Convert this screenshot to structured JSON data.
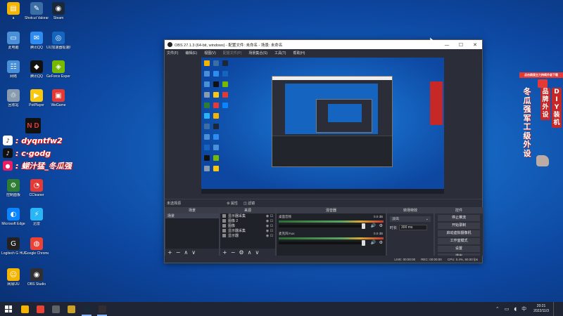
{
  "desktop": {
    "icons": [
      {
        "label": "a",
        "color": "#f4b400",
        "glyph": "▤"
      },
      {
        "label": "Shotcut Valorant",
        "color": "#3a6ea5",
        "glyph": "✎"
      },
      {
        "label": "Steam",
        "color": "#1b2838",
        "glyph": "◉"
      },
      {
        "label": "此电脑",
        "color": "#4a90d9",
        "glyph": "▭"
      },
      {
        "label": "腾讯QQ",
        "color": "#2d8cf0",
        "glyph": "✉"
      },
      {
        "label": "UU加速器极速版",
        "color": "#1565c0",
        "glyph": "◎"
      },
      {
        "label": "网络",
        "color": "#4a90d9",
        "glyph": "☷"
      },
      {
        "label": "腾讯QQ",
        "color": "#111111",
        "glyph": "◆"
      },
      {
        "label": "GeForce Experience",
        "color": "#76b900",
        "glyph": "◈"
      },
      {
        "label": "回收站",
        "color": "#8a9bb0",
        "glyph": "♲"
      },
      {
        "label": "PotPlayer",
        "color": "#f9c80e",
        "glyph": "▶"
      },
      {
        "label": "WeGame",
        "color": "#e53935",
        "glyph": "▣"
      },
      {
        "label": "控制面板",
        "color": "#2e7d32",
        "glyph": "⚙"
      },
      {
        "label": "CCleaner",
        "color": "#e53935",
        "glyph": "◔"
      },
      {
        "label": "Microsoft Edge",
        "color": "#0a84ff",
        "glyph": "◐"
      },
      {
        "label": "迅雷",
        "color": "#29b6f6",
        "glyph": "⚡"
      },
      {
        "label": "Logitech G HUB",
        "color": "#222222",
        "glyph": "G"
      },
      {
        "label": "Google Chrome",
        "color": "#ea4335",
        "glyph": "◍"
      },
      {
        "label": "网易UU",
        "color": "#f4b400",
        "glyph": "☺"
      },
      {
        "label": "OBS Studio",
        "color": "#302e31",
        "glyph": "◉"
      }
    ]
  },
  "overlay": {
    "logo_text": "N D",
    "rows": [
      {
        "icon": "douyin-icon",
        "text": ": dyqntfw2"
      },
      {
        "icon": "tiktok-icon",
        "text": ": c·godg"
      },
      {
        "icon": "live-icon",
        "text": ": 蝴汁猛_冬瓜强"
      }
    ]
  },
  "ad_banner": {
    "top_text": "点击跳蛋主力持续升级下载",
    "col1": "冬瓜强军工级外设",
    "col2": "品牌外设",
    "col3": "DIY装机"
  },
  "obs": {
    "title": "OBS 27.1.3 (64-bit, windows) - 配置文件: 未命名 - 场景: 未命名",
    "window_buttons": [
      "—",
      "☐",
      "✕"
    ],
    "menu": [
      "文件(F)",
      "编辑(E)",
      "视图(V)",
      "配置文件(P)",
      "场景集合(S)",
      "工具(T)",
      "帮助(H)"
    ],
    "scene_label": "未选择源",
    "source_props_buttons": [
      "属性",
      "滤镜"
    ],
    "docks": {
      "scenes": {
        "title": "场景",
        "items": [
          "场景"
        ]
      },
      "sources": {
        "title": "来源",
        "items": [
          "显示器采集",
          "图像 2",
          "图像",
          "显示器采集",
          "显示器"
        ]
      },
      "mixer": {
        "title": "混音器",
        "channels": [
          {
            "name": "桌面音频",
            "db": "0.0 dB"
          },
          {
            "name": "麦克风/Aux",
            "db": "0.0 dB"
          }
        ]
      },
      "transitions": {
        "title": "转场特效",
        "selected": "淡出",
        "duration_label": "时长",
        "duration": "300 ms"
      },
      "controls": {
        "title": "控件",
        "buttons": [
          "停止推流",
          "开始录制",
          "启动虚拟摄像机",
          "工作室模式",
          "设置",
          "退出"
        ]
      }
    },
    "status": {
      "live": "LIVE: 00:00:00",
      "rec": "REC: 00:00:00",
      "cpu": "CPU: 0.4%, 60.00 fps"
    }
  },
  "taskbar": {
    "apps": [
      {
        "name": "file-explorer",
        "color": "#f4b400"
      },
      {
        "name": "chrome",
        "color": "#ea4335"
      },
      {
        "name": "app-3",
        "color": "#5f6368"
      },
      {
        "name": "app-4",
        "color": "#c9a227"
      },
      {
        "name": "steam",
        "color": "#1b2838"
      },
      {
        "name": "obs",
        "color": "#302e31"
      }
    ],
    "clock_time": "20:21",
    "clock_date": "2022/11/3"
  }
}
